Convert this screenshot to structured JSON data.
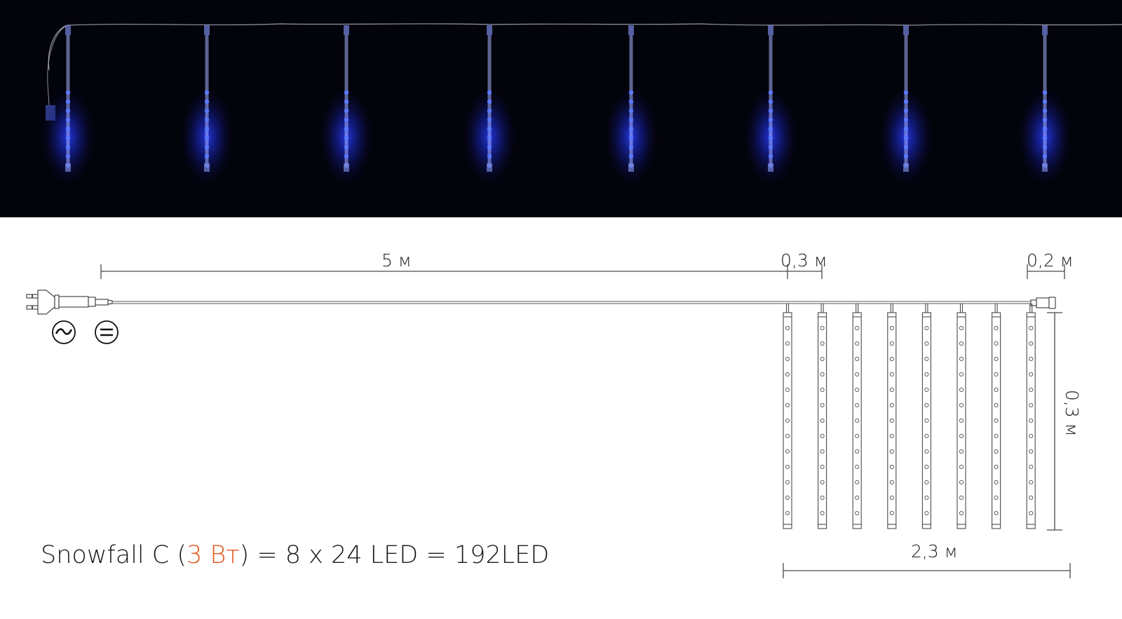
{
  "photo": {
    "caption": "Snowfall LED icicle tubes glowing blue on dark background",
    "tube_count": 8,
    "glow_color": "#1e3cff",
    "background_color": "#03030c"
  },
  "drawing": {
    "dimensions": {
      "lead_cable": "5 м",
      "tube_spacing": "0,3 м",
      "end_cable": "0,2 м",
      "tube_length": "0,3 м",
      "total_width": "2,3 м"
    },
    "symbols": {
      "ac": {
        "glyph": "~",
        "name": "alternating-current"
      },
      "dc": {
        "glyph": "=",
        "name": "direct-current"
      }
    },
    "tube_count": 8,
    "leds_per_tube_drawn": 13,
    "line_color": "#4a4a4a"
  },
  "formula": {
    "product": "Snowfall C",
    "open_paren": " (",
    "power": "3 Вт",
    "rest": ") = 8 x 24 LED = 192LED",
    "accent_color": "#e0571e"
  }
}
